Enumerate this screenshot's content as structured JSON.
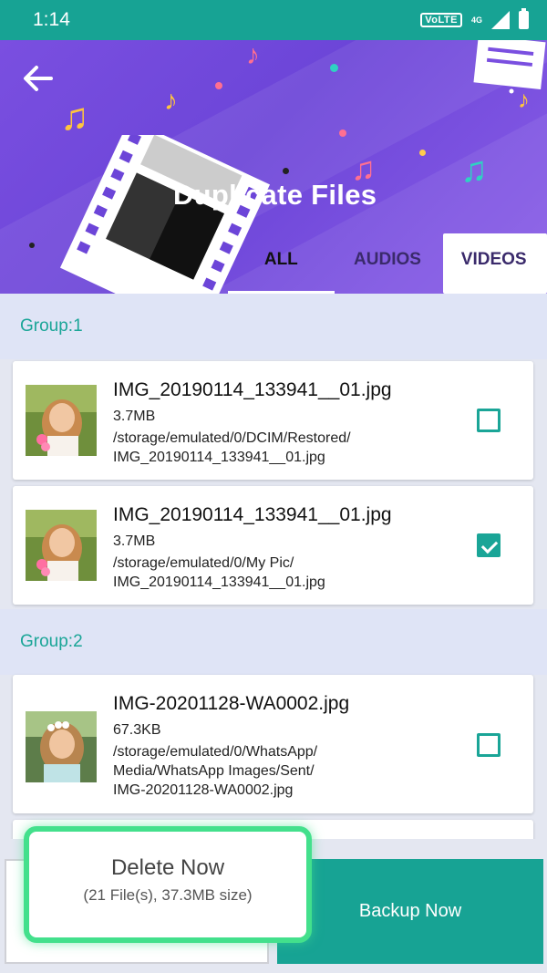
{
  "status_bar": {
    "time": "1:14",
    "volte": "VoLTE",
    "network": "4G"
  },
  "header": {
    "title": "Duplicate Files",
    "tabs": [
      {
        "label": "ALL",
        "active": true
      },
      {
        "label": "AUDIOS",
        "active": false
      },
      {
        "label": "VIDEOS",
        "active": false
      }
    ]
  },
  "groups": [
    {
      "label": "Group:1",
      "files": [
        {
          "name": "IMG_20190114_133941__01.jpg",
          "size": "3.7MB",
          "path_line1": "/storage/emulated/0/DCIM/Restored/",
          "path_line2": "IMG_20190114_133941__01.jpg",
          "checked": false
        },
        {
          "name": "IMG_20190114_133941__01.jpg",
          "size": "3.7MB",
          "path_line1": "/storage/emulated/0/My Pic/",
          "path_line2": "IMG_20190114_133941__01.jpg",
          "checked": true
        }
      ]
    },
    {
      "label": "Group:2",
      "files": [
        {
          "name": "IMG-20201128-WA0002.jpg",
          "size": "67.3KB",
          "path_line1": "/storage/emulated/0/WhatsApp/",
          "path_line2": "Media/WhatsApp Images/Sent/",
          "path_line3": "IMG-20201128-WA0002.jpg",
          "checked": false
        }
      ]
    }
  ],
  "actions": {
    "delete_label": "Delete Now",
    "delete_sub": "(21 File(s), 37.3MB size)",
    "backup_label": "Backup Now"
  },
  "colors": {
    "accent": "#17a394",
    "header": "#7a4fe0",
    "highlight": "#43e08c"
  }
}
